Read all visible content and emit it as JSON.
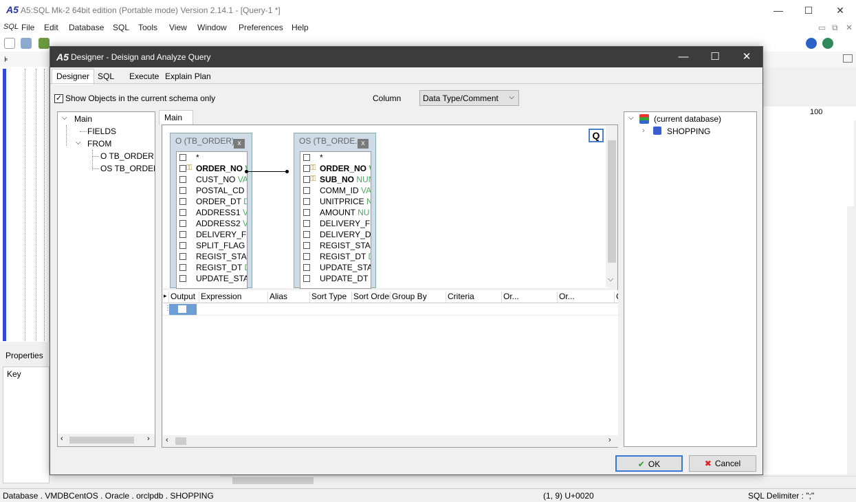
{
  "main_window": {
    "title": "A5:SQL Mk-2 64bit edition (Portable mode) Version 2.14.1 - [Query-1 *]",
    "minimize": "—",
    "maximize": "☐",
    "close": "✕",
    "menu": [
      "SQL",
      "File",
      "Edit",
      "Database",
      "SQL",
      "Tools",
      "View",
      "Window",
      "Preferences",
      "Help"
    ],
    "mdi_min": "▭",
    "mdi_restore": "⧉",
    "mdi_close": "✕"
  },
  "left_panel": {
    "properties_label": "Properties",
    "key_label": "Key"
  },
  "right_background": {
    "ruler_label": "100"
  },
  "status_bar": {
    "database": "Database . VMDBCentOS . Oracle . orclpdb . SHOPPING",
    "position": "(1, 9) U+0020",
    "delimiter": "SQL Delimiter : \";\""
  },
  "dialog": {
    "title": "Designer - Deisign and Analyze Query",
    "minimize": "—",
    "maximize": "☐",
    "close": "✕",
    "tabs": [
      "Designer",
      "SQL",
      "Execute",
      "Explain Plan"
    ],
    "show_objects_label": "Show Objects in the current schema only",
    "show_objects_checked": "✓",
    "column_label": "Column",
    "column_select_value": "Data Type/Comment",
    "tree": {
      "root": "Main",
      "fields": "FIELDS",
      "from": "FROM",
      "items": [
        "O TB_ORDER",
        "OS TB_ORDER_S"
      ]
    },
    "center_tab": "Main",
    "q_button": "Q",
    "tables": [
      {
        "header": "O (TB_ORDER)",
        "columns": [
          {
            "name": "*",
            "type": "",
            "key": false
          },
          {
            "name": "ORDER_NO",
            "type": "V",
            "key": true
          },
          {
            "name": "CUST_NO",
            "type": "VAR",
            "key": false
          },
          {
            "name": "POSTAL_CD",
            "type": "V",
            "key": false
          },
          {
            "name": "ORDER_DT",
            "type": "DA",
            "key": false
          },
          {
            "name": "ADDRESS1",
            "type": "VA",
            "key": false
          },
          {
            "name": "ADDRESS2",
            "type": "VA",
            "key": false
          },
          {
            "name": "DELIVERY_FLA",
            "type": "",
            "key": false
          },
          {
            "name": "SPLIT_FLAG",
            "type": "C",
            "key": false
          },
          {
            "name": "REGIST_STAFF",
            "type": "",
            "key": false
          },
          {
            "name": "REGIST_DT",
            "type": "DA",
            "key": false
          },
          {
            "name": "UPDATE_STAF",
            "type": "",
            "key": false
          }
        ]
      },
      {
        "header": "OS (TB_ORDE...",
        "columns": [
          {
            "name": "*",
            "type": "",
            "key": false
          },
          {
            "name": "ORDER_NO",
            "type": "V",
            "key": true
          },
          {
            "name": "SUB_NO",
            "type": "NUN",
            "key": true
          },
          {
            "name": "COMM_ID",
            "type": "VA",
            "key": false
          },
          {
            "name": "UNITPRICE",
            "type": "NU",
            "key": false
          },
          {
            "name": "AMOUNT",
            "type": "NU",
            "key": false
          },
          {
            "name": "DELIVERY_FLA",
            "type": "",
            "key": false
          },
          {
            "name": "DELIVERY_DAT",
            "type": "",
            "key": false
          },
          {
            "name": "REGIST_STAFF",
            "type": "",
            "key": false
          },
          {
            "name": "REGIST_DT",
            "type": "DA",
            "key": false
          },
          {
            "name": "UPDATE_STAF",
            "type": "",
            "key": false
          },
          {
            "name": "UPDATE_DT",
            "type": "D",
            "key": false
          }
        ]
      }
    ],
    "grid_columns": [
      "Output",
      "Expression",
      "Alias",
      "Sort Type",
      "Sort Order",
      "Group By",
      "Criteria",
      "Or...",
      "Or...",
      "C"
    ],
    "objects": {
      "root": "(current database)",
      "child": "SHOPPING"
    },
    "ok_label": "OK",
    "cancel_label": "Cancel"
  },
  "colors": {
    "dialog_titlebar": "#3c3c3c",
    "accent_blue": "#2d4bd8",
    "type_green": "#4aa860",
    "table_bg": "#cfdbe7"
  }
}
